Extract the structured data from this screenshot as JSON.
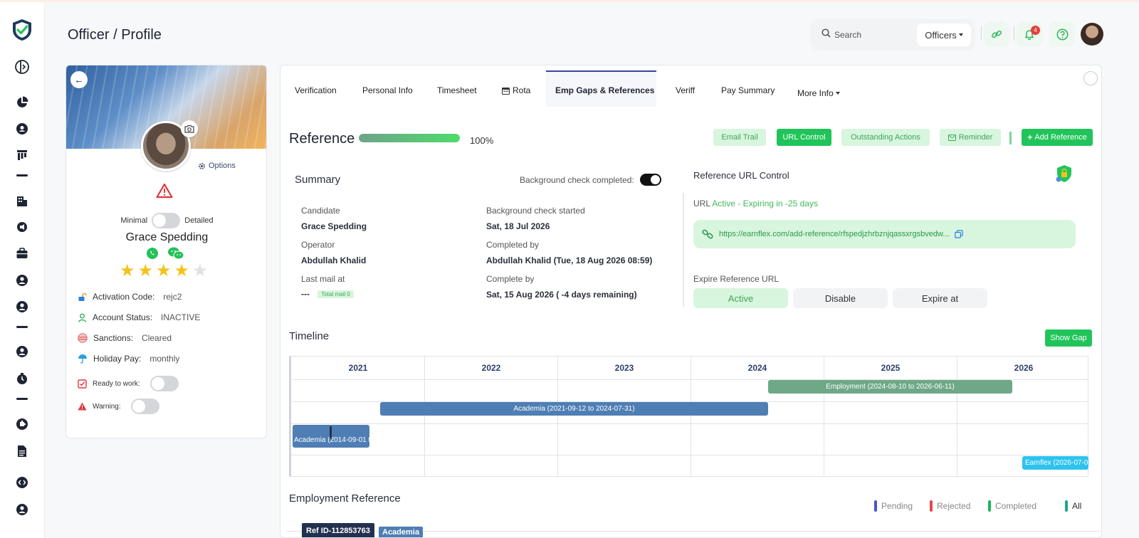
{
  "header": {
    "page_title": "Officer / Profile",
    "search_placeholder": "Search",
    "dropdown_label": "Officers",
    "notification_count": "4"
  },
  "profile": {
    "options_label": "Options",
    "view_min_label": "Minimal",
    "view_detail_label": "Detailed",
    "name": "Grace Spedding",
    "rating": 4,
    "rating_max": 5,
    "activation_label": "Activation Code:",
    "activation_value": "rejc2",
    "account_label": "Account Status:",
    "account_value": "INACTIVE",
    "sanctions_label": "Sanctions:",
    "sanctions_value": "Cleared",
    "holiday_label": "Holiday Pay:",
    "holiday_value": "monthly",
    "ready_label": "Ready to work:",
    "warning_label": "Warning:"
  },
  "tabs": [
    {
      "label": "Verification"
    },
    {
      "label": "Personal Info"
    },
    {
      "label": "Timesheet"
    },
    {
      "label": "Rota"
    },
    {
      "label": "Emp Gaps & References"
    },
    {
      "label": "Veriff"
    },
    {
      "label": "Pay Summary"
    },
    {
      "label": "More Info"
    }
  ],
  "reference": {
    "title": "Reference",
    "progress_pct": 100,
    "progress_label": "100%",
    "actions": {
      "email_trail": "Email Trail",
      "url_control": "URL Control",
      "outstanding": "Outstanding Actions",
      "reminder": "Reminder",
      "add_reference": "Add Reference"
    }
  },
  "summary": {
    "title": "Summary",
    "bg_check_label": "Background check completed:",
    "candidate_label": "Candidate",
    "candidate_value": "Grace Spedding",
    "operator_label": "Operator",
    "operator_value": "Abdullah Khalid",
    "last_mail_label": "Last mail at",
    "last_mail_value": "---",
    "total_mail_label": "Total mail 0",
    "bg_started_label": "Background check started",
    "bg_started_value": "Sat, 18 Jul 2026",
    "completed_by_label": "Completed by",
    "completed_by_value": "Abdullah Khalid (Tue, 18 Aug 2026 08:59)",
    "complete_by_label": "Complete by",
    "complete_by_value": "Sat, 15 Aug 2026 ( -4 days remaining)"
  },
  "url_control": {
    "title": "Reference URL Control",
    "status_prefix": "URL",
    "status_value": "Active - Expiring in -25 days",
    "url": "https://earnflex.com/add-reference/rfspedjzhrbznjqassxrgsbvedw...",
    "expire_label": "Expire Reference URL",
    "options": [
      "Active",
      "Disable",
      "Expire at"
    ]
  },
  "timeline": {
    "title": "Timeline",
    "show_gap_label": "Show Gap",
    "years": [
      "2021",
      "2022",
      "2023",
      "2024",
      "2025",
      "2026"
    ],
    "bars": [
      {
        "label": "Employment (2024-08-10 to 2026-06-11)",
        "kind": "employment"
      },
      {
        "label": "Academia (2021-09-12 to 2024-07-31)",
        "kind": "academia"
      },
      {
        "label": "Academia (2014-09-01 t",
        "kind": "academia"
      },
      {
        "label": "Earnflex (2026-07-0",
        "kind": "earnflex"
      }
    ]
  },
  "employment_reference": {
    "title": "Employment Reference",
    "legend": [
      {
        "label": "Pending",
        "color": "#4a55c8"
      },
      {
        "label": "Rejected",
        "color": "#e5484d"
      },
      {
        "label": "Completed",
        "color": "#21b45a"
      },
      {
        "label": "All",
        "color": "#1ea58a"
      }
    ],
    "ref_id": "Ref ID-112853763",
    "ref_type": "Academia"
  },
  "colors": {
    "brand_green": "#21c45a",
    "light_green": "#d8f5de",
    "tab_accent": "#3743a8",
    "academia": "#4f7eb4",
    "employment": "#6fa887",
    "earnflex": "#2ec3ef"
  }
}
